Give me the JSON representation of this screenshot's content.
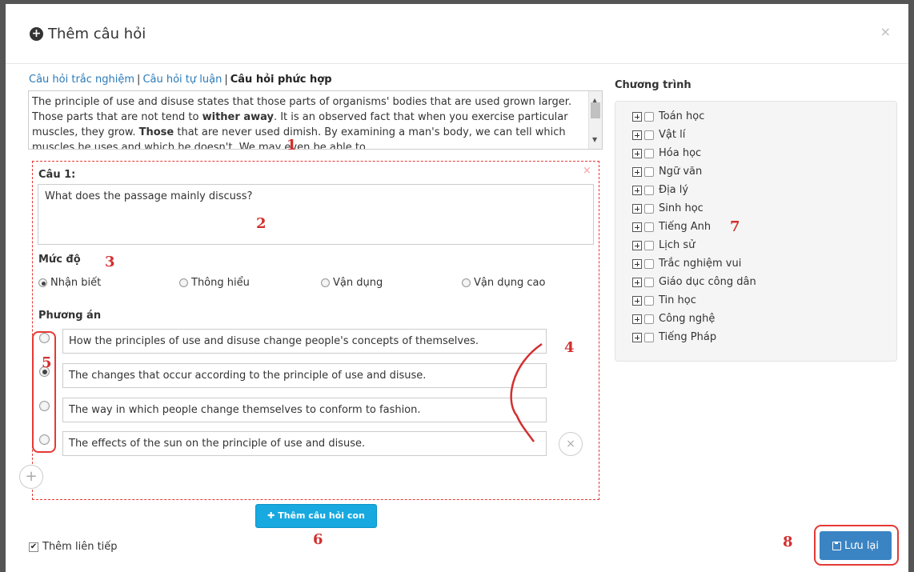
{
  "modal": {
    "title": "Thêm câu hỏi",
    "close_glyph": "×"
  },
  "tabs": [
    {
      "label": "Câu hỏi trắc nghiệm",
      "active": false
    },
    {
      "label": "Câu hỏi tự luận",
      "active": false
    },
    {
      "label": "Câu hỏi phức hợp",
      "active": true
    }
  ],
  "passage": {
    "part1": "The principle of use and disuse states that those parts of organisms' bodies that are used grown larger. Those parts that are not tend to ",
    "bold1": "wither away",
    "part2": ". It is an observed fact that when you exercise particular muscles, they grow. ",
    "bold2": "Those",
    "part3": " that are never used dimish. By examining a man's body, we can tell which muscles he uses and which he doesn't. We may even be able to"
  },
  "question": {
    "label": "Câu 1:",
    "text": "What does the passage mainly discuss?",
    "remove_glyph": "×"
  },
  "level": {
    "label": "Mức độ",
    "options": [
      "Nhận biết",
      "Thông hiểu",
      "Vận dụng",
      "Vận dụng cao"
    ],
    "selected": "Nhận biết"
  },
  "answers": {
    "label": "Phương án",
    "options": [
      "How the principles of use and disuse change people's concepts of themselves.",
      "The changes that occur according to the principle of use and disuse.",
      "The way in which people change themselves to conform to fashion.",
      "The effects of the sun on the principle of use and disuse."
    ],
    "selected_index": 1
  },
  "buttons": {
    "add_subquestion": "Thêm câu hỏi con",
    "save": "Lưu lại",
    "add_answer_glyph": "+",
    "remove_answer_glyph": "×"
  },
  "continuous": {
    "label": "Thêm liên tiếp",
    "checked": true
  },
  "program": {
    "label": "Chương trình",
    "items": [
      "Toán học",
      "Vật lí",
      "Hóa học",
      "Ngữ văn",
      "Địa lý",
      "Sinh học",
      "Tiếng Anh",
      "Lịch sử",
      "Trắc nghiệm vui",
      "Giáo dục công dân",
      "Tin học",
      "Công nghệ",
      "Tiếng Pháp"
    ]
  },
  "annotations": [
    "1",
    "2",
    "3",
    "4",
    "5",
    "6",
    "7",
    "8"
  ],
  "colors": {
    "accent_blue": "#17a9e0",
    "save_blue": "#3a84c3",
    "link_blue": "#2a7ab8",
    "annotation_red": "#d32f2f"
  }
}
